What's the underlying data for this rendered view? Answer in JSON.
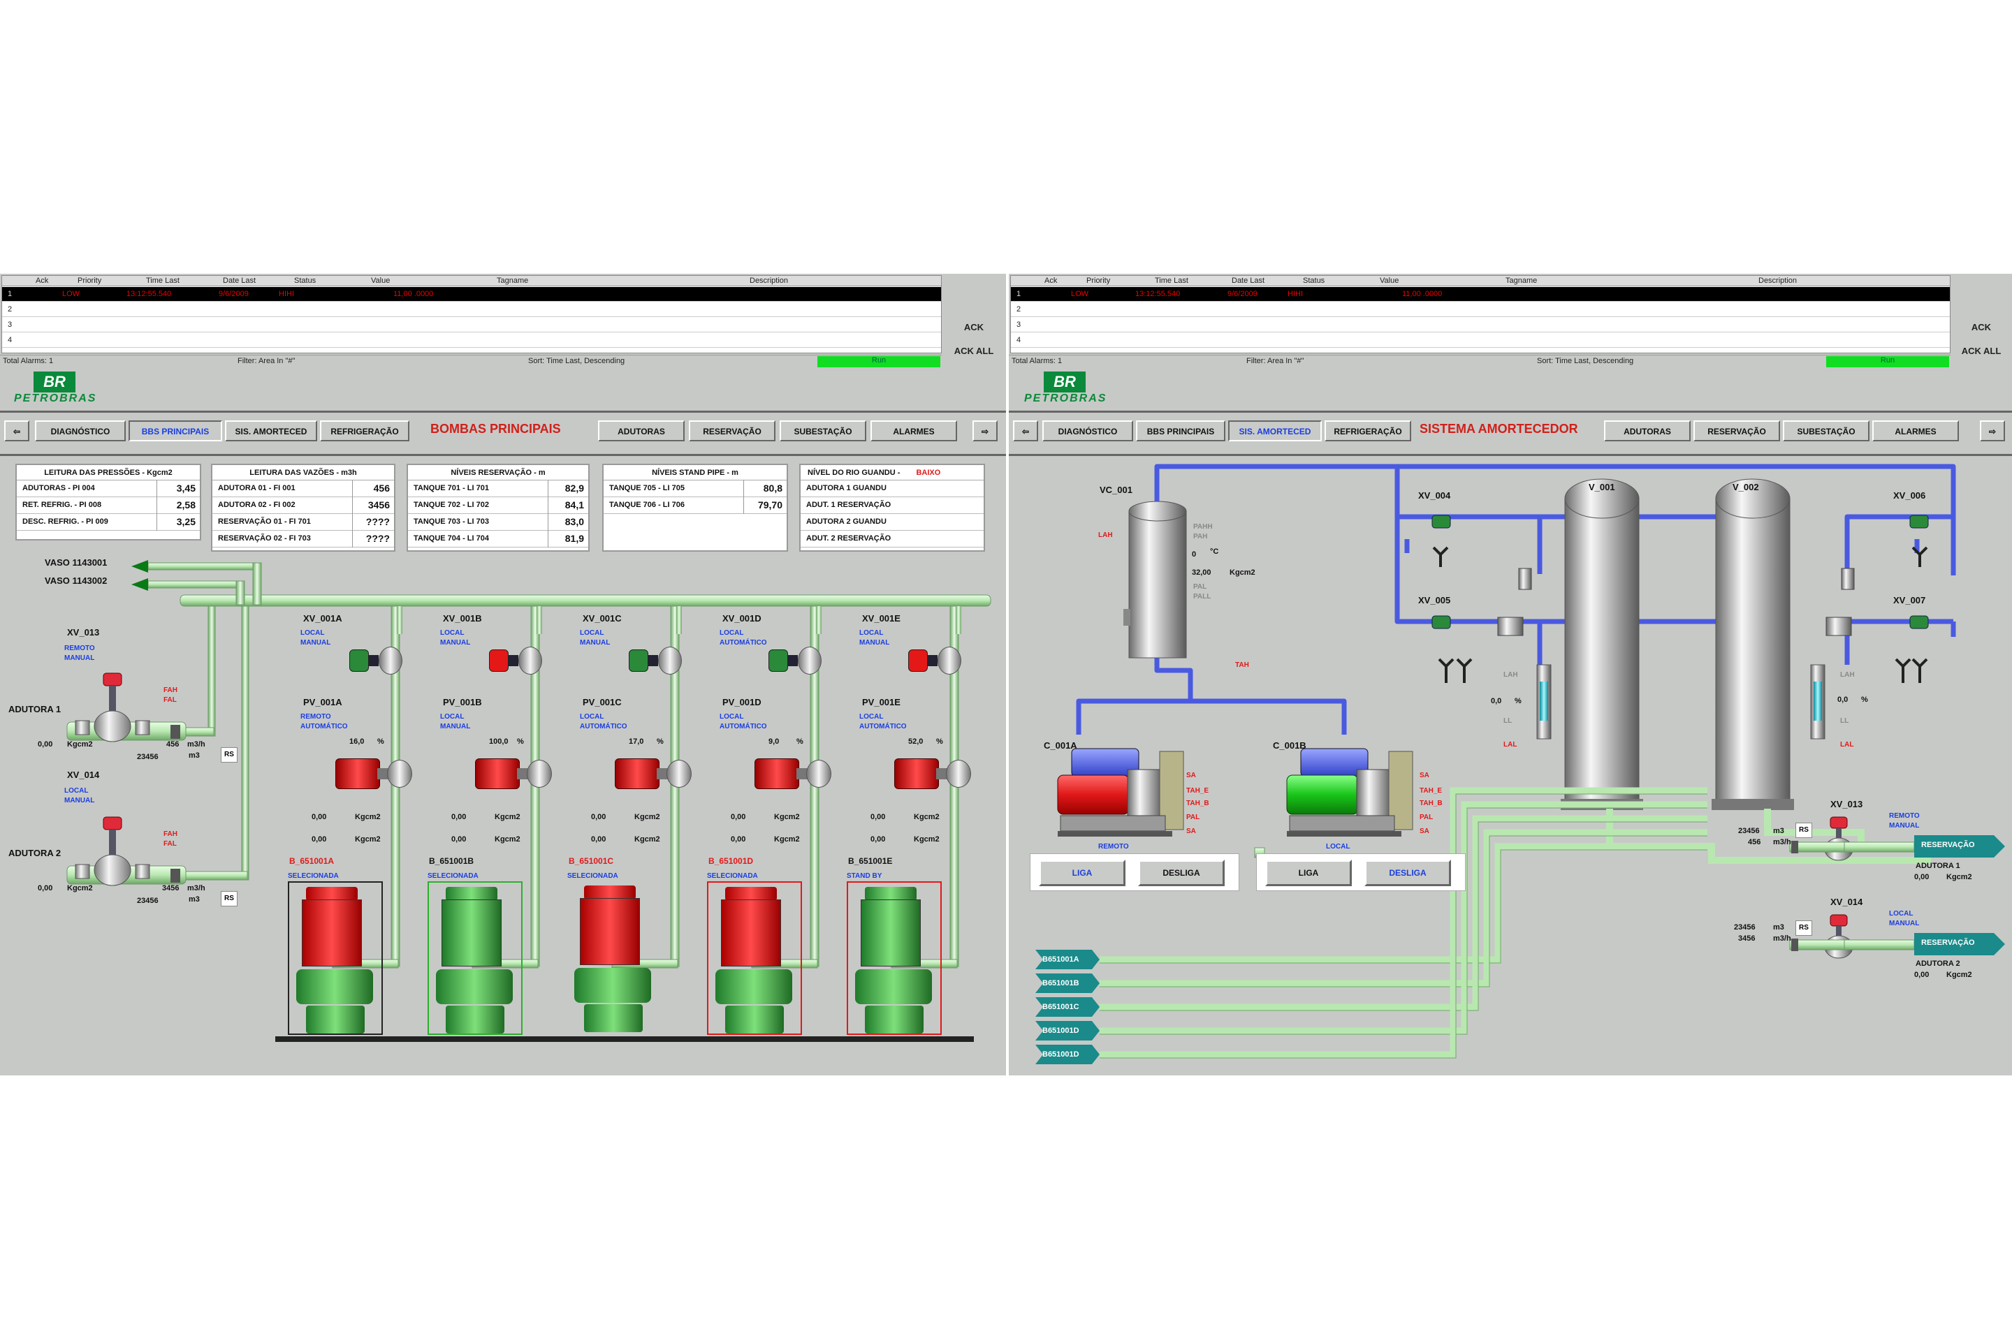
{
  "alarm_summary": {
    "columns": [
      "Ack",
      "Priority",
      "Time Last",
      "Date Last",
      "Status",
      "Value",
      "Tagname",
      "Description"
    ],
    "rows": [
      "1",
      "2",
      "3",
      "4"
    ],
    "selected_row": {
      "priority": "LOW",
      "time": "13:12:55.540",
      "date": "9/6/2009",
      "status": "HIHI",
      "value": "11,00 .0000"
    },
    "footer_total": "Total Alarms: 1",
    "footer_filter": "Filter: Area In \"#\"",
    "footer_sort": "Sort: Time Last, Descending",
    "run_label": "Run",
    "ack_label": "ACK",
    "ack_all_label": "ACK ALL"
  },
  "logo": {
    "mark": "BR",
    "word": "PETROBRAS"
  },
  "nav": {
    "back": "⇦",
    "forward": "⇨",
    "items": [
      "DIAGNÓSTICO",
      "BBS PRINCIPAIS",
      "SIS. AMORTECED",
      "REFRIGERAÇÃO",
      "ADUTORAS",
      "RESERVAÇÃO",
      "SUBESTAÇÃO",
      "ALARMES"
    ]
  },
  "left": {
    "title": "BOMBAS PRINCIPAIS",
    "pressures": {
      "title": "LEITURA DAS PRESSÕES - Kgcm2",
      "rows": [
        [
          "ADUTORAS - PI 004",
          "3,45"
        ],
        [
          "RET. REFRIG. - PI 008",
          "2,58"
        ],
        [
          "DESC. REFRIG. - PI 009",
          "3,25"
        ]
      ]
    },
    "flows": {
      "title": "LEITURA DAS VAZÕES - m3h",
      "rows": [
        [
          "ADUTORA 01 - FI 001",
          "456"
        ],
        [
          "ADUTORA 02 - FI 002",
          "3456"
        ],
        [
          "RESERVAÇÃO 01 - FI 701",
          "????"
        ],
        [
          "RESERVAÇÃO 02 - FI 703",
          "????"
        ]
      ]
    },
    "reservoir": {
      "title": "NÍVEIS RESERVAÇÃO - m",
      "rows": [
        [
          "TANQUE 701 - LI 701",
          "82,9"
        ],
        [
          "TANQUE 702 - LI 702",
          "84,1"
        ],
        [
          "TANQUE 703 - LI 703",
          "83,0"
        ],
        [
          "TANQUE 704 - LI 704",
          "81,9"
        ]
      ]
    },
    "standpipe": {
      "title": "NÍVEIS STAND PIPE - m",
      "rows": [
        [
          "TANQUE 705 - LI 705",
          "80,8"
        ],
        [
          "TANQUE 706 - LI 706",
          "79,70"
        ]
      ]
    },
    "river": {
      "title": "NÍVEL DO RIO GUANDU -",
      "status": "BAIXO",
      "rows": [
        "ADUTORA 1 GUANDU",
        "ADUT. 1 RESERVAÇÃO",
        "ADUTORA 2 GUANDU",
        "ADUT. 2 RESERVAÇÃO"
      ]
    },
    "vaso1": "VASO 1143001",
    "vaso2": "VASO 1143002",
    "xv013": {
      "tag": "XV_013",
      "mode1": "REMOTO",
      "mode2": "MANUAL",
      "fah": "FAH",
      "fal": "FAL",
      "line": "ADUTORA 1",
      "press": "0,00",
      "pu": "Kgcm2",
      "flow": "456",
      "fu": "m3/h",
      "tot": "23456",
      "tu": "m3",
      "rs": "RS"
    },
    "xv014": {
      "tag": "XV_014",
      "mode1": "LOCAL",
      "mode2": "MANUAL",
      "fah": "FAH",
      "fal": "FAL",
      "line": "ADUTORA 2",
      "press": "0,00",
      "pu": "Kgcm2",
      "flow": "3456",
      "fu": "m3/h",
      "tot": "23456",
      "tu": "m3",
      "rs": "RS"
    },
    "units": [
      {
        "xv": "XV_001A",
        "m1": "LOCAL",
        "m2": "MANUAL",
        "pv": "PV_001A",
        "p1": "REMOTO",
        "p2": "AUTOMÁTICO",
        "pct": "16,0",
        "a": "0,00",
        "b": "0,00",
        "b_tag": "B_651001A",
        "state": "SELECIONADA",
        "color": "#e51818",
        "frame": "#222222",
        "valve": "#2a8a3a"
      },
      {
        "xv": "XV_001B",
        "m1": "LOCAL",
        "m2": "MANUAL",
        "pv": "PV_001B",
        "p1": "LOCAL",
        "p2": "MANUAL",
        "pct": "100,0",
        "a": "0,00",
        "b": "0,00",
        "b_tag": "B_651001B",
        "state": "SELECIONADA",
        "color": "#3db03d",
        "frame": "#2bb02b",
        "valve": "#e51818"
      },
      {
        "xv": "XV_001C",
        "m1": "LOCAL",
        "m2": "MANUAL",
        "pv": "PV_001C",
        "p1": "LOCAL",
        "p2": "AUTOMÁTICO",
        "pct": "17,0",
        "a": "0,00",
        "b": "0,00",
        "b_tag": "B_651001C",
        "state": "SELECIONADA",
        "color": "#e51818",
        "frame": "",
        "valve": "#2a8a3a"
      },
      {
        "xv": "XV_001D",
        "m1": "LOCAL",
        "m2": "AUTOMÁTICO",
        "pv": "PV_001D",
        "p1": "LOCAL",
        "p2": "AUTOMÁTICO",
        "pct": "9,0",
        "a": "0,00",
        "b": "0,00",
        "b_tag": "B_651001D",
        "state": "SELECIONADA",
        "color": "#e51818",
        "frame": "#e51818",
        "valve": "#2a8a3a"
      },
      {
        "xv": "XV_001E",
        "m1": "LOCAL",
        "m2": "MANUAL",
        "pv": "PV_001E",
        "p1": "LOCAL",
        "p2": "AUTOMÁTICO",
        "pct": "52,0",
        "a": "0,00",
        "b": "0,00",
        "b_tag": "B_651001E",
        "state": "STAND BY",
        "color": "#3db03d",
        "frame": "#e51818",
        "valve": "#e51818"
      }
    ],
    "pct_unit": "%",
    "p_unit": "Kgcm2"
  },
  "right": {
    "title": "SISTEMA AMORTECEDOR",
    "vc": {
      "tag": "VC_001",
      "lah": "LAH",
      "pahh": "PAHH",
      "pah": "PAH",
      "temp": "0",
      "tu": "°C",
      "press": "32,00",
      "pu": "Kgcm2",
      "pal": "PAL",
      "pall": "PALL",
      "tah": "TAH"
    },
    "v001": "V_001",
    "v002": "V_002",
    "xv004": "XV_004",
    "xv005": "XV_005",
    "xv006": "XV_006",
    "xv007": "XV_007",
    "level_left": {
      "lah": "LAH",
      "val": "0,0",
      "u": "%",
      "ll": "LL",
      "lal": "LAL"
    },
    "level_right": {
      "lah": "LAH",
      "val": "0,0",
      "u": "%",
      "ll": "LL",
      "lal": "LAL"
    },
    "compA": {
      "tag": "C_001A",
      "mode": "REMOTO",
      "alarms": [
        "SA",
        "TAH_E",
        "TAH_B",
        "PAL",
        "SA"
      ],
      "liga": "LIGA",
      "desliga": "DESLIGA"
    },
    "compB": {
      "tag": "C_001B",
      "mode": "LOCAL",
      "alarms": [
        "SA",
        "TAH_E",
        "TAH_B",
        "PAL",
        "SA"
      ],
      "liga": "LIGA",
      "desliga": "DESLIGA"
    },
    "pumps": [
      "B651001A",
      "B651001B",
      "B651001C",
      "B651001D",
      "B651001D"
    ],
    "xv013": {
      "tag": "XV_013",
      "m1": "REMOTO",
      "m2": "MANUAL",
      "v1": "23456",
      "v2": "456",
      "u1": "m3",
      "u2": "m3/h",
      "rs": "RS",
      "dest": "RESERVAÇÃO",
      "line": "ADUTORA 1",
      "press": "0,00",
      "pu": "Kgcm2"
    },
    "xv014": {
      "tag": "XV_014",
      "m1": "LOCAL",
      "m2": "MANUAL",
      "v1": "23456",
      "v2": "3456",
      "u1": "m3",
      "u2": "m3/h",
      "rs": "RS",
      "dest": "RESERVAÇÃO",
      "line": "ADUTORA 2",
      "press": "0,00",
      "pu": "Kgcm2"
    }
  },
  "colors": {
    "pipe_green": "#c8f0c0",
    "pipe_blue": "#4a5ae0",
    "panel": "#c7c9c7",
    "alarm_red": "#e01a1a",
    "mode_blue": "#1a3ee0",
    "teal": "#1a8a8a"
  }
}
